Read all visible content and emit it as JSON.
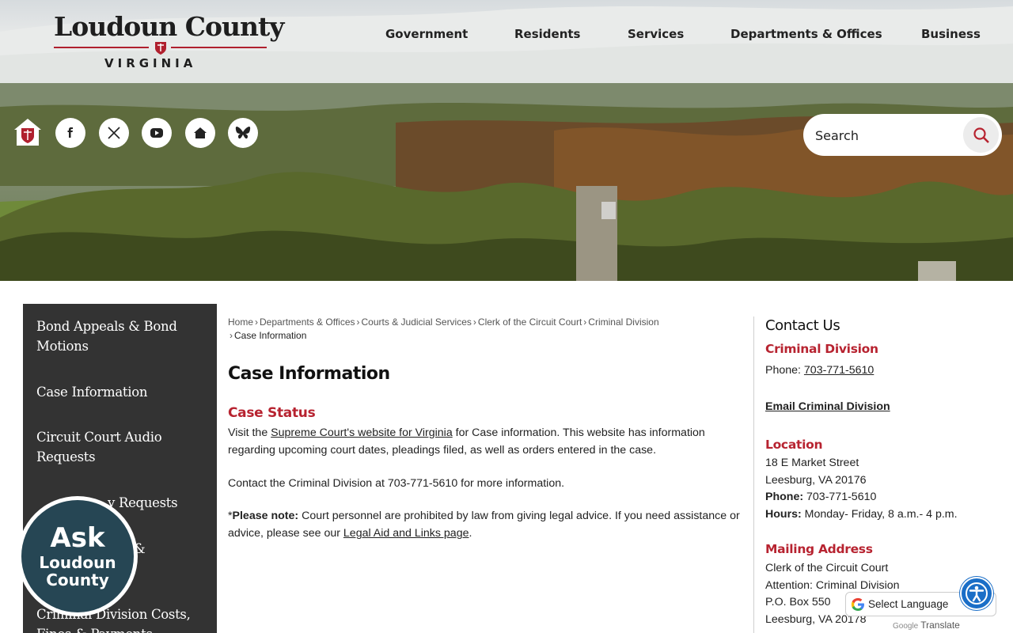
{
  "header": {
    "logo_name": "Loudoun County",
    "logo_state": "VIRGINIA",
    "nav": [
      "Government",
      "Residents",
      "Services",
      "Departments & Offices",
      "Business"
    ]
  },
  "banner": {
    "social_icons": [
      "home-crest-icon",
      "facebook-icon",
      "x-twitter-icon",
      "youtube-icon",
      "nextdoor-icon",
      "bluesky-icon"
    ],
    "search_placeholder": "Search"
  },
  "sidebar": {
    "items": [
      "Bond Appeals & Bond Motions",
      "Case Information",
      "Circuit Court Audio Requests",
      "Copy Request Requests",
      "Criminal Division Costs, Fines & Payments"
    ],
    "visible_fragments": {
      "item3_tail": "y Requests",
      "item4_amp": "&",
      "item5_a": "Crim",
      "item5_b": "inal Division Costs,",
      "item5_line2": "Fines & Payments"
    }
  },
  "ask_badge": {
    "line1": "Ask",
    "line2": "Loudoun",
    "line3": "County"
  },
  "breadcrumb": {
    "links": [
      "Home",
      "Departments & Offices",
      "Courts & Judicial Services",
      "Clerk of the Circuit Court",
      "Criminal Division"
    ],
    "current": "Case Information",
    "separator": "›"
  },
  "main": {
    "title": "Case Information",
    "section_title": "Case Status",
    "p1_before": "Visit the ",
    "p1_link": "Supreme Court's website for Virginia",
    "p1_after": " for Case information. This website has information regarding upcoming court dates, pleadings filed, as well as orders entered in the case.",
    "p2": "Contact the Criminal Division at 703-771-5610 for more information.",
    "p3_prefix": "*",
    "p3_bold": "Please note:",
    "p3_text": " Court personnel are prohibited by law from giving legal advice. If you need assistance or advice, please see our ",
    "p3_link": "Legal Aid and Links page",
    "p3_end": "."
  },
  "contact": {
    "title": "Contact Us",
    "division": "Criminal Division",
    "phone_label": "Phone: ",
    "phone": "703-771-5610",
    "email_link": "Email Criminal Division",
    "location_head": "Location",
    "street": "18 E Market Street",
    "city": "Leesburg, VA 20176",
    "phone_bold": "Phone:",
    "phone2": " 703-771-5610",
    "hours_bold": "Hours:",
    "hours": " Monday- Friday, 8 a.m.- 4 p.m.",
    "mailing_head": "Mailing Address",
    "mail1": "Clerk of the Circuit Court",
    "mail2": "Attention: Criminal Division",
    "mail3": "P.O. Box 550",
    "mail4": "Leesburg, VA 20178"
  },
  "translate": {
    "label": "Select Language",
    "powered_google": "Google",
    "powered_text": "Translate"
  },
  "colors": {
    "accent": "#b72330",
    "sidebar": "#333333",
    "ask": "#264654",
    "a11y": "#1a6ec7"
  }
}
